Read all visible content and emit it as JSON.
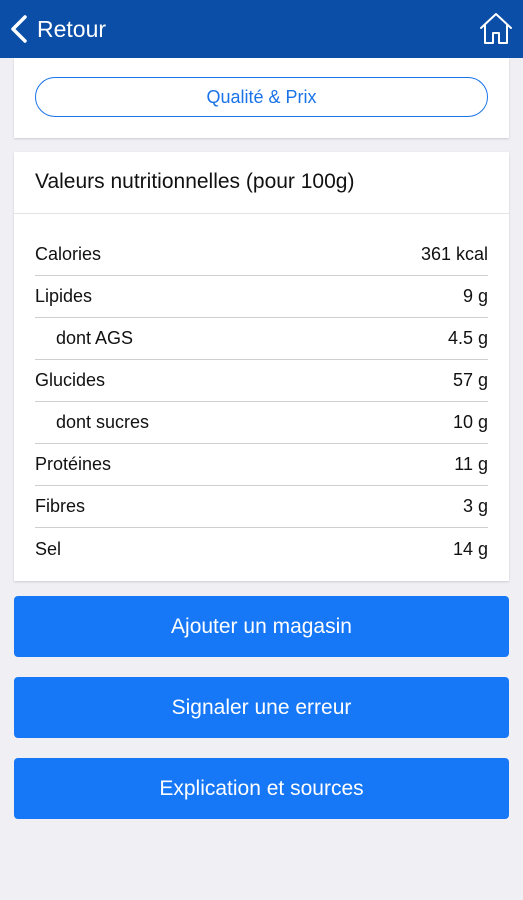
{
  "header": {
    "back_label": "Retour",
    "back_icon": "chevron-left-icon",
    "home_icon": "home-icon",
    "bar_color": "#0a4ea8"
  },
  "quality_price_button": "Qualité & Prix",
  "nutrition": {
    "title": "Valeurs nutritionnelles (pour 100g)",
    "rows": [
      {
        "name": "Calories",
        "value": "361 kcal"
      },
      {
        "name": "Lipides",
        "value": "9 g"
      },
      {
        "name": "dont AGS",
        "value": "4.5 g"
      },
      {
        "name": "Glucides",
        "value": "57 g"
      },
      {
        "name": "dont sucres",
        "value": "10 g"
      },
      {
        "name": "Protéines",
        "value": "11 g"
      },
      {
        "name": "Fibres",
        "value": "3 g"
      },
      {
        "name": "Sel",
        "value": "14 g"
      }
    ]
  },
  "actions": {
    "add_store": "Ajouter un magasin",
    "report_error": "Signaler une erreur",
    "explanation": "Explication et sources",
    "button_color": "#1677f7"
  }
}
